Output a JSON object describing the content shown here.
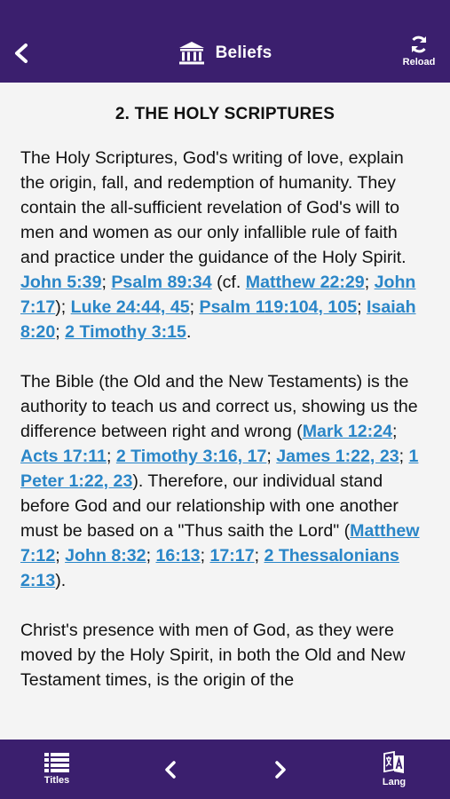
{
  "header": {
    "title": "Beliefs",
    "reload_label": "Reload"
  },
  "content": {
    "heading": "2. THE HOLY SCRIPTURES",
    "p1": {
      "t0": "The Holy Scriptures, God's writing of love, explain the origin, fall, and redemption of humanity. They contain the all-sufficient revelation of God's will to men and women as our only infallible rule of faith and practice under the guidance of the Holy Spirit. ",
      "r0": "John 5:39",
      "s1": "; ",
      "r1": "Psalm 89:34",
      "s2": " (cf. ",
      "r2": "Matthew 22:29",
      "s3": "; ",
      "r3": "John 7:17",
      "s4": "); ",
      "r4": "Luke 24:44, 45",
      "s5": "; ",
      "r5": "Psalm 119:104, 105",
      "s6": "; ",
      "r6": "Isaiah 8:20",
      "s7": "; ",
      "r7": "2 Timothy 3:15",
      "s8": "."
    },
    "p2": {
      "t0": "The Bible (the Old and the New Testaments) is the authority to teach us and correct us, showing us the difference between right and wrong (",
      "r0": "Mark 12:24",
      "s1": "; ",
      "r1": "Acts 17:11",
      "s2": "; ",
      "r2": "2 Timothy 3:16, 17",
      "s3": "; ",
      "r3": "James 1:22, 23",
      "s4": "; ",
      "r4": "1 Peter 1:22, 23",
      "s5": "). Therefore, our individual stand before God and our relationship with one another must be based on a \"Thus saith the Lord\" (",
      "r5": "Matthew 7:12",
      "s6": "; ",
      "r6": "John 8:32",
      "s7": "; ",
      "r7": "16:13",
      "s8": "; ",
      "r8": "17:17",
      "s9": "; ",
      "r9": "2 Thessalonians 2:13",
      "s10": ")."
    },
    "p3": {
      "t0": "Christ's presence with men of God, as they were moved by the Holy Spirit, in both the Old and New Testament times, is the origin of the"
    }
  },
  "footer": {
    "titles_label": "Titles",
    "lang_label": "Lang"
  },
  "colors": {
    "bar": "#3b1f6e",
    "link": "#2a86c8",
    "background": "#f4f4f4"
  }
}
